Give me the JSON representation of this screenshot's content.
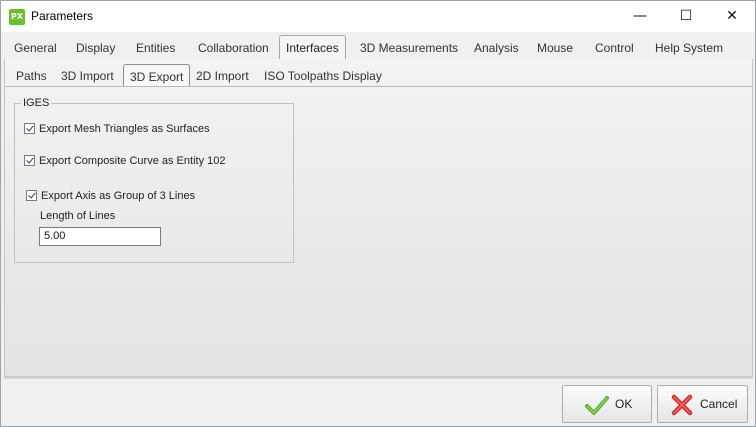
{
  "window": {
    "logo_text": "PX",
    "title": "Parameters",
    "minimize_glyph": "—",
    "maximize_glyph": "☐",
    "close_glyph": "✕"
  },
  "tabs": [
    {
      "label": "General"
    },
    {
      "label": "Display"
    },
    {
      "label": "Entities"
    },
    {
      "label": "Collaboration"
    },
    {
      "label": "Interfaces"
    },
    {
      "label": "3D Measurements"
    },
    {
      "label": "Analysis"
    },
    {
      "label": "Mouse"
    },
    {
      "label": "Control"
    },
    {
      "label": "Help System"
    }
  ],
  "active_tab": "Interfaces",
  "subtabs": [
    {
      "label": "Paths"
    },
    {
      "label": "3D Import"
    },
    {
      "label": "3D Export"
    },
    {
      "label": "2D Import"
    },
    {
      "label": "ISO Toolpaths Display"
    }
  ],
  "active_subtab": "3D Export",
  "iges": {
    "group_title": "IGES",
    "options": [
      {
        "label": "Export Mesh Triangles as Surfaces",
        "checked": true
      },
      {
        "label": "Export Composite Curve as Entity 102",
        "checked": true
      },
      {
        "label": "Export Axis as Group of 3 Lines",
        "checked": true
      }
    ],
    "length_label": "Length of Lines",
    "length_value": "5.00"
  },
  "buttons": {
    "ok": "OK",
    "cancel": "Cancel"
  },
  "icons": {
    "ok": "check-icon",
    "cancel": "cross-icon"
  },
  "colors": {
    "accent_green": "#6cbf2f",
    "check_green": "#5aa92b",
    "cancel_red": "#d62b2b"
  }
}
